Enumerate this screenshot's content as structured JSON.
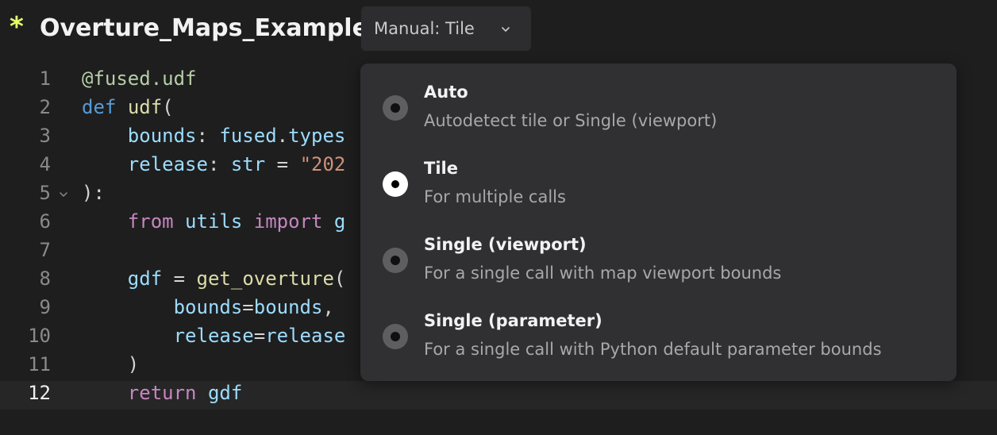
{
  "header": {
    "unsaved_marker": "*",
    "title": "Overture_Maps_Example",
    "mode_select": {
      "label": "Manual: Tile",
      "icon": "chevron-down-icon"
    }
  },
  "editor": {
    "active_line": 12,
    "line_numbers": [
      "1",
      "2",
      "3",
      "4",
      "5",
      "6",
      "7",
      "8",
      "9",
      "10",
      "11",
      "12"
    ],
    "lines": [
      [
        {
          "t": "@fused.udf",
          "c": "deco"
        }
      ],
      [
        {
          "t": "def",
          "c": "kw"
        },
        {
          "t": " ",
          "c": "plain"
        },
        {
          "t": "udf",
          "c": "fn"
        },
        {
          "t": "(",
          "c": "plain"
        }
      ],
      [
        {
          "t": "    ",
          "c": "plain"
        },
        {
          "t": "bounds",
          "c": "var"
        },
        {
          "t": ": ",
          "c": "plain"
        },
        {
          "t": "fused",
          "c": "var"
        },
        {
          "t": ".",
          "c": "plain"
        },
        {
          "t": "types",
          "c": "var"
        }
      ],
      [
        {
          "t": "    ",
          "c": "plain"
        },
        {
          "t": "release",
          "c": "var"
        },
        {
          "t": ": ",
          "c": "plain"
        },
        {
          "t": "str",
          "c": "var"
        },
        {
          "t": " = ",
          "c": "plain"
        },
        {
          "t": "\"202",
          "c": "str"
        }
      ],
      [
        {
          "t": "):",
          "c": "plain"
        }
      ],
      [
        {
          "t": "    ",
          "c": "plain"
        },
        {
          "t": "from",
          "c": "ctrl"
        },
        {
          "t": " ",
          "c": "plain"
        },
        {
          "t": "utils",
          "c": "var"
        },
        {
          "t": " ",
          "c": "plain"
        },
        {
          "t": "import",
          "c": "ctrl"
        },
        {
          "t": " g",
          "c": "var"
        }
      ],
      [],
      [
        {
          "t": "    ",
          "c": "plain"
        },
        {
          "t": "gdf",
          "c": "var"
        },
        {
          "t": " = ",
          "c": "plain"
        },
        {
          "t": "get_overture",
          "c": "fn"
        },
        {
          "t": "(",
          "c": "plain"
        }
      ],
      [
        {
          "t": "        ",
          "c": "plain"
        },
        {
          "t": "bounds",
          "c": "var"
        },
        {
          "t": "=",
          "c": "plain"
        },
        {
          "t": "bounds",
          "c": "var"
        },
        {
          "t": ",",
          "c": "plain"
        }
      ],
      [
        {
          "t": "        ",
          "c": "plain"
        },
        {
          "t": "release",
          "c": "var"
        },
        {
          "t": "=",
          "c": "plain"
        },
        {
          "t": "release",
          "c": "var"
        }
      ],
      [
        {
          "t": "    )",
          "c": "plain"
        }
      ],
      [
        {
          "t": "    ",
          "c": "plain"
        },
        {
          "t": "return",
          "c": "ctrl"
        },
        {
          "t": " ",
          "c": "plain"
        },
        {
          "t": "gdf",
          "c": "var"
        }
      ]
    ],
    "fold_line": 5
  },
  "dropdown": {
    "options": [
      {
        "title": "Auto",
        "description": "Autodetect tile or Single (viewport)",
        "selected": false
      },
      {
        "title": "Tile",
        "description": "For multiple calls",
        "selected": true
      },
      {
        "title": "Single (viewport)",
        "description": "For a single call with map viewport bounds",
        "selected": false
      },
      {
        "title": "Single (parameter)",
        "description": "For a single call with Python default parameter bounds",
        "selected": false
      }
    ]
  },
  "colors": {
    "background": "#1e1e1e",
    "unsaved_marker": "#e5ff6b",
    "dropdown_bg": "#303032",
    "keyword": "#569cd6",
    "function": "#dcdcaa",
    "variable": "#9cdcfe",
    "string": "#ce9178",
    "control": "#c586c0",
    "decorator": "#b5cea8"
  }
}
